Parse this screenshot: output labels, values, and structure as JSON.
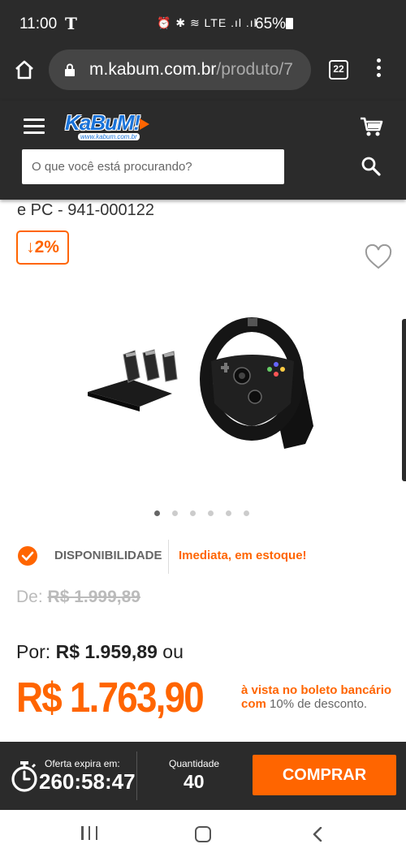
{
  "status_bar": {
    "time": "11:00",
    "carrier_icon": "T",
    "system_icons": "⏰ ✱ ≋ LTE .ıl .ıl",
    "battery": "65%"
  },
  "browser": {
    "url_host": "m.kabum.com.br",
    "url_path": "/produto/7",
    "tab_count": "22"
  },
  "header": {
    "logo_text": "KaBuM!",
    "logo_sub": "www.kabum.com.br",
    "search_placeholder": "O que você está procurando?"
  },
  "product": {
    "title_fragment": "e PC - 941-000122",
    "discount": "↓2%",
    "image_count": 6,
    "active_image_index": 0,
    "availability_label": "DISPONIBILIDADE",
    "availability_value": "Imediata, em estoque!",
    "old_price_prefix": "De:",
    "old_price": "R$ 1.999,89",
    "por_prefix": "Por:",
    "por_price": "R$ 1.959,89",
    "por_suffix": "ou",
    "cash_price": "R$ 1.763,90",
    "boleto_line1": "à vista no boleto bancário",
    "boleto_com": "com",
    "boleto_discount": "10% de desconto."
  },
  "bottom_bar": {
    "offer_label": "Oferta expira em:",
    "offer_timer": "260:58:47",
    "quantity_label": "Quantidade",
    "quantity_value": "40",
    "buy_label": "COMPRAR"
  },
  "colors": {
    "accent": "#ff6500",
    "dark": "#2b2b2b",
    "brand_blue": "#1a73d9"
  }
}
